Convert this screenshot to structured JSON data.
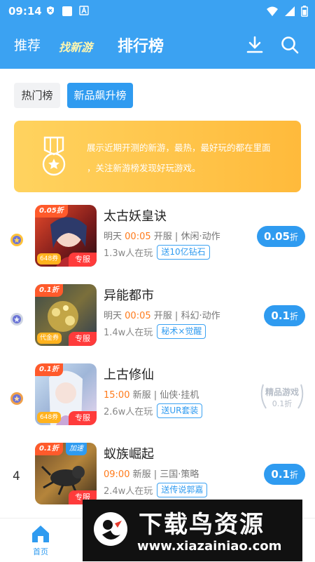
{
  "status_bar": {
    "time": "09:14",
    "icons": [
      "shield-icon",
      "square-icon",
      "a-icon"
    ],
    "right_icons": [
      "wifi-icon",
      "signal-icon",
      "battery-icon"
    ]
  },
  "header": {
    "tabs": [
      {
        "label": "推荐"
      },
      {
        "label": "找新游"
      },
      {
        "label": "排行榜"
      }
    ],
    "icons": [
      "download-icon",
      "search-icon"
    ]
  },
  "subtabs": [
    {
      "label": "热门榜"
    },
    {
      "label": "新品飙升榜"
    }
  ],
  "banner": {
    "text_line1": "展示近期开测的新游，最热，最好玩的都在里面",
    "text_line2": "，关注新游榜发现好玩游戏。"
  },
  "games": [
    {
      "rank": "1",
      "name": "太古妖皇诀",
      "discount_tag": "0.05折",
      "coupon": "648券",
      "server_tag": "专服",
      "time": "明天",
      "time_hl": "00:05",
      "open": "开服",
      "category": "休闲·动作",
      "players": "1.3w人在玩",
      "gift": "送10亿钻石",
      "price": "0.05",
      "price_unit": "折"
    },
    {
      "rank": "2",
      "name": "异能都市",
      "discount_tag": "0.1折",
      "coupon": "代金券",
      "server_tag": "专服",
      "time": "明天",
      "time_hl": "00:05",
      "open": "开服",
      "category": "科幻·动作",
      "players": "1.4w人在玩",
      "gift": "秘术×觉醒",
      "price": "0.1",
      "price_unit": "折"
    },
    {
      "rank": "3",
      "name": "上古修仙",
      "discount_tag": "0.1折",
      "coupon": "648券",
      "server_tag": "专服",
      "time": "",
      "time_hl": "15:00",
      "open": "新服",
      "category": "仙侠·挂机",
      "players": "2.6w人在玩",
      "gift": "送UR套装",
      "quality_label": "精品游戏",
      "quality_sub": "0.1折"
    },
    {
      "rank": "4",
      "name": "蚁族崛起",
      "discount_tag": "0.1折",
      "extra_tag": "加速",
      "server_tag": "专服",
      "time": "",
      "time_hl": "09:00",
      "open": "新服",
      "category": "三国·策略",
      "players": "2.4w人在玩",
      "gift": "送传说郭嘉",
      "price": "0.1",
      "price_unit": "折"
    }
  ],
  "bottom_nav": {
    "home_label": "首页"
  },
  "watermark": {
    "title": "下载鸟资源",
    "url": "www.xiazainiao.com"
  },
  "colors": {
    "accent": "#3ba2f2",
    "orange": "#ff7a1a",
    "banner": "#ffc548",
    "server_red": "#ff3b3b"
  }
}
